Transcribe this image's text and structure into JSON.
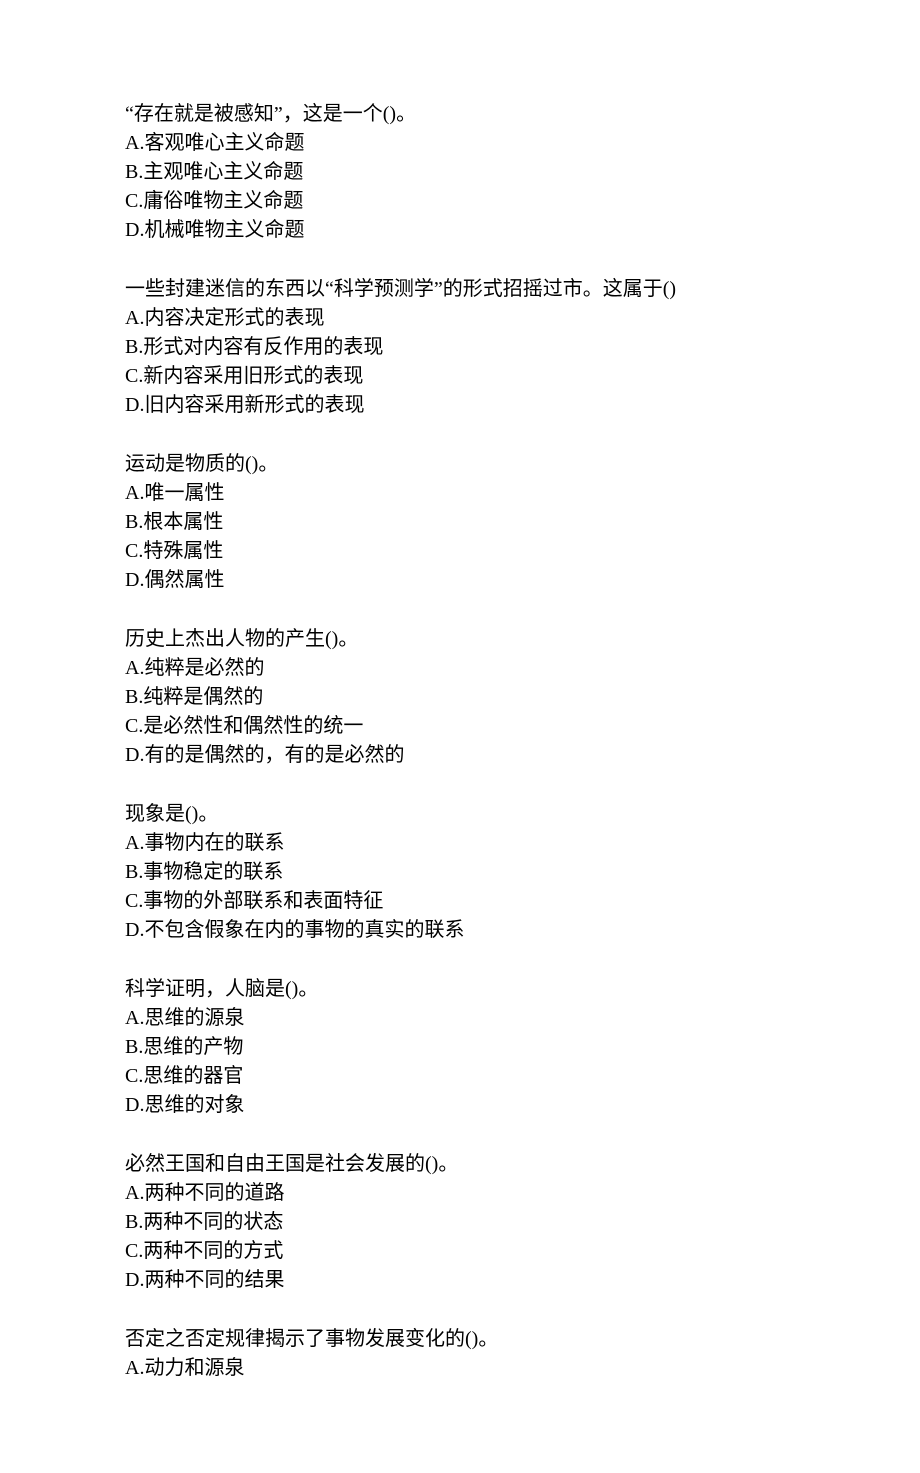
{
  "questions": [
    {
      "stem": "“存在就是被感知”，这是一个()。",
      "options": [
        "A.客观唯心主义命题",
        "B.主观唯心主义命题",
        "C.庸俗唯物主义命题",
        "D.机械唯物主义命题"
      ]
    },
    {
      "stem": "一些封建迷信的东西以“科学预测学”的形式招摇过市。这属于()",
      "options": [
        "A.内容决定形式的表现",
        "B.形式对内容有反作用的表现",
        "C.新内容采用旧形式的表现",
        "D.旧内容采用新形式的表现"
      ]
    },
    {
      "stem": "运动是物质的()。",
      "options": [
        "A.唯一属性",
        "B.根本属性",
        "C.特殊属性",
        "D.偶然属性"
      ]
    },
    {
      "stem": "历史上杰出人物的产生()。",
      "options": [
        "A.纯粹是必然的",
        "B.纯粹是偶然的",
        "C.是必然性和偶然性的统一",
        "D.有的是偶然的，有的是必然的"
      ]
    },
    {
      "stem": "现象是()。",
      "options": [
        "A.事物内在的联系",
        "B.事物稳定的联系",
        "C.事物的外部联系和表面特征",
        "D.不包含假象在内的事物的真实的联系"
      ]
    },
    {
      "stem": "科学证明，人脑是()。",
      "options": [
        "A.思维的源泉",
        "B.思维的产物",
        "C.思维的器官",
        "D.思维的对象"
      ]
    },
    {
      "stem": "必然王国和自由王国是社会发展的()。",
      "options": [
        "A.两种不同的道路",
        "B.两种不同的状态",
        "C.两种不同的方式",
        "D.两种不同的结果"
      ]
    },
    {
      "stem": "否定之否定规律揭示了事物发展变化的()。",
      "options": [
        "A.动力和源泉"
      ]
    }
  ]
}
